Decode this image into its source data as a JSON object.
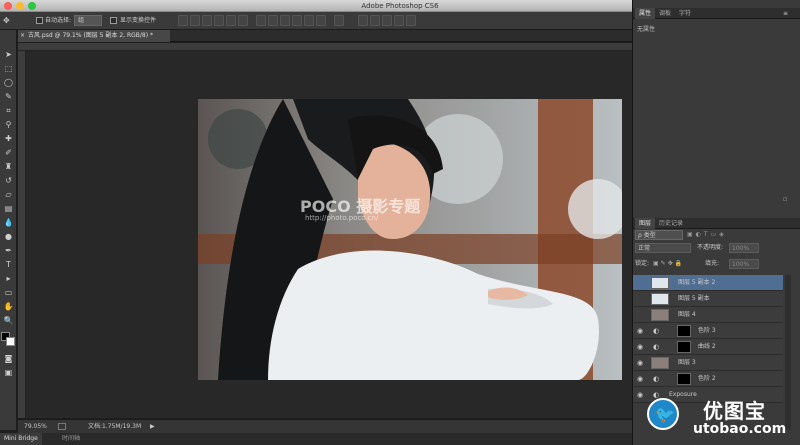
{
  "app": {
    "title": "Adobe Photoshop CS6"
  },
  "options_bar": {
    "auto_select_label": "自动选择:",
    "auto_select_value": "组",
    "show_transform_label": "显示变换控件"
  },
  "document_tab": {
    "label": "古风.psd @ 79.1% (图层 5 副本 2, RGB/8) *"
  },
  "status_bar": {
    "zoom": "79.05%",
    "doc_info": "文档:1.75M/19.3M"
  },
  "bottom_tabs": [
    "Mini Bridge",
    "时间轴"
  ],
  "properties_panel": {
    "tabs": [
      "属性",
      "调板",
      "字符"
    ],
    "content": "无属性"
  },
  "layers_panel": {
    "tabs": [
      "图层",
      "历史记录"
    ],
    "filter_label": "类型",
    "blend_mode": "正常",
    "opacity_label": "不透明度:",
    "opacity_value": "100%",
    "lock_label": "锁定:",
    "fill_label": "填充:",
    "fill_value": "100%",
    "layers": [
      {
        "name": "图层 5 副本 2",
        "selected": true
      },
      {
        "name": "图层 5 副本"
      },
      {
        "name": "图层 4"
      },
      {
        "name": "色阶 3"
      },
      {
        "name": "曲线 2"
      },
      {
        "name": "图层 3"
      },
      {
        "name": "色阶 2"
      },
      {
        "name": "Exposure"
      }
    ]
  },
  "canvas": {
    "watermark_main": "POCO 摄影专题",
    "watermark_url": "http://photo.poco.cn/"
  },
  "site_watermark": {
    "name": "优图宝",
    "url": "utobao.com"
  },
  "colors": {
    "accent": "#4f6e92",
    "panel": "#3a3a3a",
    "canvas": "#282828"
  }
}
